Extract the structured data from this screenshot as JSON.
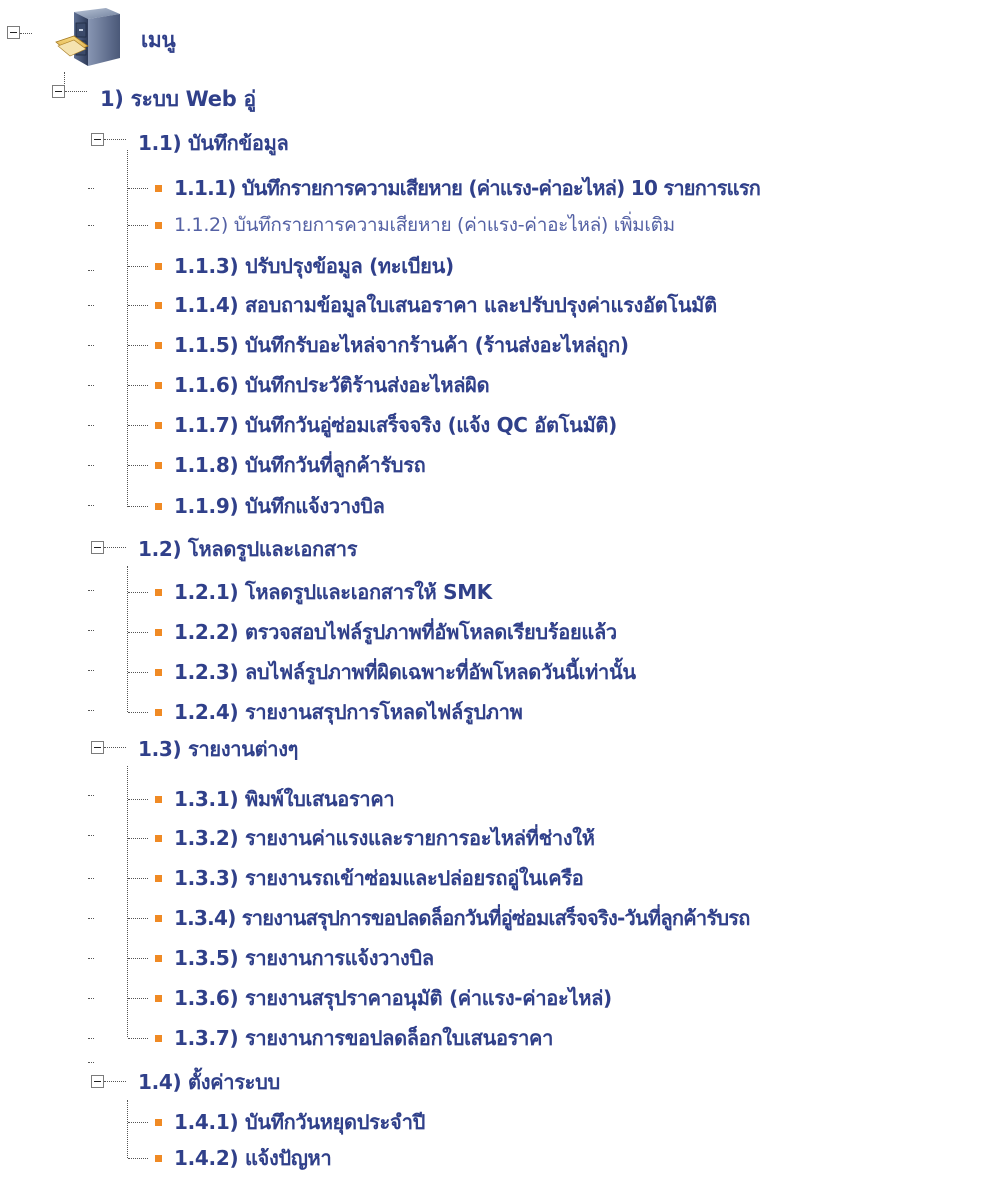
{
  "menu": {
    "root_label": "เมนู",
    "root_icon": "file-cabinet-icon",
    "system": {
      "label": "1) ระบบ Web อู่",
      "groups": [
        {
          "label": "1.1) บันทึกข้อมูล",
          "items": [
            "1.1.1) บันทึกรายการความเสียหาย (ค่าแรง-ค่าอะไหล่) 10 รายการแรก",
            "1.1.2) บันทึกรายการความเสียหาย (ค่าแรง-ค่าอะไหล่) เพิ่มเติม",
            "1.1.3) ปรับปรุงข้อมูล (ทะเบียน)",
            "1.1.4) สอบถามข้อมูลใบเสนอราคา และปรับปรุงค่าแรงอัตโนมัติ",
            "1.1.5) บันทึกรับอะไหล่จากร้านค้า (ร้านส่งอะไหล่ถูก)",
            "1.1.6) บันทึกประวัติร้านส่งอะไหล่ผิด",
            "1.1.7) บันทึกวันอู่ซ่อมเสร็จจริง (แจ้ง QC อัตโนมัติ)",
            "1.1.8) บันทึกวันที่ลูกค้ารับรถ",
            "1.1.9) บันทึกแจ้งวางบิล"
          ]
        },
        {
          "label": "1.2) โหลดรูปและเอกสาร",
          "items": [
            "1.2.1) โหลดรูปและเอกสารให้ SMK",
            "1.2.2) ตรวจสอบไฟล์รูปภาพที่อัพโหลดเรียบร้อยแล้ว",
            "1.2.3) ลบไฟล์รูปภาพที่ผิดเฉพาะที่อัพโหลดวันนี้เท่านั้น",
            "1.2.4) รายงานสรุปการโหลดไฟล์รูปภาพ"
          ]
        },
        {
          "label": "1.3) รายงานต่างๆ",
          "items": [
            "1.3.1) พิมพ์ใบเสนอราคา",
            "1.3.2) รายงานค่าแรงและรายการอะไหล่ที่ช่างให้",
            "1.3.3) รายงานรถเข้าซ่อมและปล่อยรถอู่ในเครือ",
            "1.3.4) รายงานสรุปการขอปลดล็อกวันที่อู่ซ่อมเสร็จจริง-วันที่ลูกค้ารับรถ",
            "1.3.5) รายงานการแจ้งวางบิล",
            "1.3.6) รายงานสรุปราคาอนุมัติ (ค่าแรง-ค่าอะไหล่)",
            "1.3.7) รายงานการขอปลดล็อกใบเสนอราคา"
          ]
        },
        {
          "label": "1.4) ตั้งค่าระบบ",
          "items": [
            "1.4.1) บันทึกวันหยุดประจำปี",
            "1.4.2) แจ้งปัญหา"
          ]
        }
      ]
    }
  },
  "colors": {
    "text": "#30408a",
    "bullet": "#f08a24"
  }
}
